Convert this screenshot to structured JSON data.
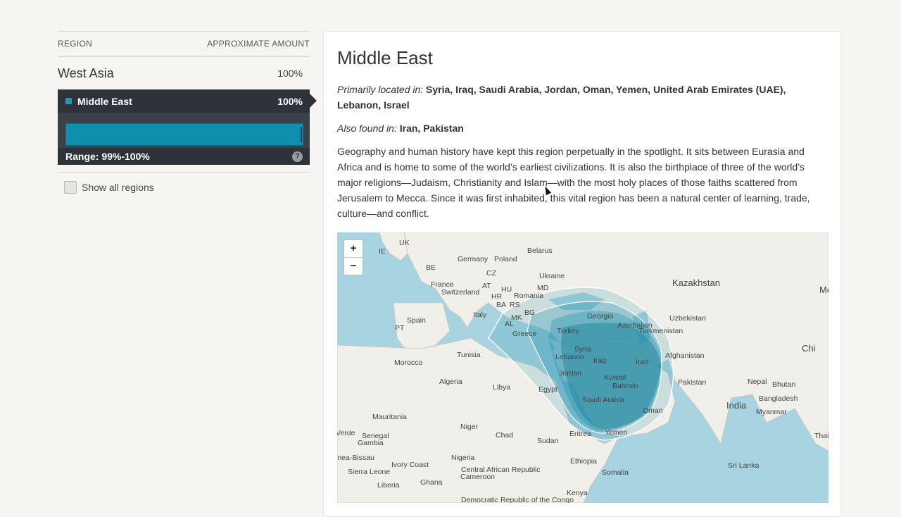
{
  "table": {
    "col_region": "REGION",
    "col_amount": "APPROXIMATE AMOUNT"
  },
  "region": {
    "name": "West Asia",
    "pct": "100%"
  },
  "subregion": {
    "name": "Middle East",
    "pct": "100%",
    "range": "Range: 99%-100%",
    "bar_fraction": 1.0,
    "color": "#0e8fad"
  },
  "show_all_label": "Show all regions",
  "detail": {
    "title": "Middle East",
    "primary_label": "Primarily located in:",
    "primary_value": "Syria, Iraq, Saudi Arabia, Jordan, Oman, Yemen, United Arab Emirates (UAE), Lebanon, Israel",
    "also_label": "Also found in:",
    "also_value": "Iran, Pakistan",
    "description": "Geography and human history have kept this region perpetually in the spotlight. It sits between Eurasia and Africa and is home to some of the world’s earliest civilizations. It is also the birthplace of three of the world’s major religions—Judaism, Christianity and Islam—with the most holy places of those faiths scattered from Jerusalem to Mecca. Since it was first inhabited, this vital region has been a natural center of learning, trade, culture—and conflict."
  },
  "map": {
    "zoom_in": "+",
    "zoom_out": "−",
    "labels": [
      {
        "t": "UK"
      },
      {
        "t": "IE"
      },
      {
        "t": "Belarus"
      },
      {
        "t": "Germany"
      },
      {
        "t": "Poland"
      },
      {
        "t": "BE"
      },
      {
        "t": "CZ"
      },
      {
        "t": "Ukraine"
      },
      {
        "t": "France"
      },
      {
        "t": "AT"
      },
      {
        "t": "HU"
      },
      {
        "t": "Switzerland"
      },
      {
        "t": "MD"
      },
      {
        "t": "HR"
      },
      {
        "t": "Romania"
      },
      {
        "t": "BA"
      },
      {
        "t": "RS"
      },
      {
        "t": "BG"
      },
      {
        "t": "Kazakhstan"
      },
      {
        "t": "Mon"
      },
      {
        "t": "Spain"
      },
      {
        "t": "PT"
      },
      {
        "t": "Italy"
      },
      {
        "t": "MK"
      },
      {
        "t": "AL"
      },
      {
        "t": "Georgia"
      },
      {
        "t": "Uzbekistan"
      },
      {
        "t": "Azerbaijan"
      },
      {
        "t": "Turkmenistan"
      },
      {
        "t": "Greece"
      },
      {
        "t": "Turkey"
      },
      {
        "t": "Chi"
      },
      {
        "t": "Tunisia"
      },
      {
        "t": "Syria"
      },
      {
        "t": "Afghanistan"
      },
      {
        "t": "Lebanon"
      },
      {
        "t": "Iraq"
      },
      {
        "t": "Iran"
      },
      {
        "t": "Morocco"
      },
      {
        "t": "Jordan"
      },
      {
        "t": "Kuwait"
      },
      {
        "t": "Algeria"
      },
      {
        "t": "Libya"
      },
      {
        "t": "Bahrain"
      },
      {
        "t": "Pakistan"
      },
      {
        "t": "Egypt"
      },
      {
        "t": "Nepal"
      },
      {
        "t": "Bhutan"
      },
      {
        "t": "Saudi Arabia"
      },
      {
        "t": "Bangladesh"
      },
      {
        "t": "India"
      },
      {
        "t": "Oman"
      },
      {
        "t": "Myanmar"
      },
      {
        "t": "Mauritania"
      },
      {
        "t": "Niger"
      },
      {
        "t": "Chad"
      },
      {
        "t": "Sudan"
      },
      {
        "t": "Eritrea"
      },
      {
        "t": "Yemen"
      },
      {
        "t": "Thaila"
      },
      {
        "t": "Verde"
      },
      {
        "t": "Senegal"
      },
      {
        "t": "Gambia"
      },
      {
        "t": "inea-Bissau"
      },
      {
        "t": "Nigeria"
      },
      {
        "t": "Ethiopia"
      },
      {
        "t": "Sierra Leone"
      },
      {
        "t": "Ivory Coast"
      },
      {
        "t": "Central African Republic"
      },
      {
        "t": "Somalia"
      },
      {
        "t": "Sri Lanka"
      },
      {
        "t": "Cameroon"
      },
      {
        "t": "Liberia"
      },
      {
        "t": "Ghana"
      },
      {
        "t": "Kenya"
      },
      {
        "t": "Democratic Republic of the Congo"
      }
    ]
  }
}
